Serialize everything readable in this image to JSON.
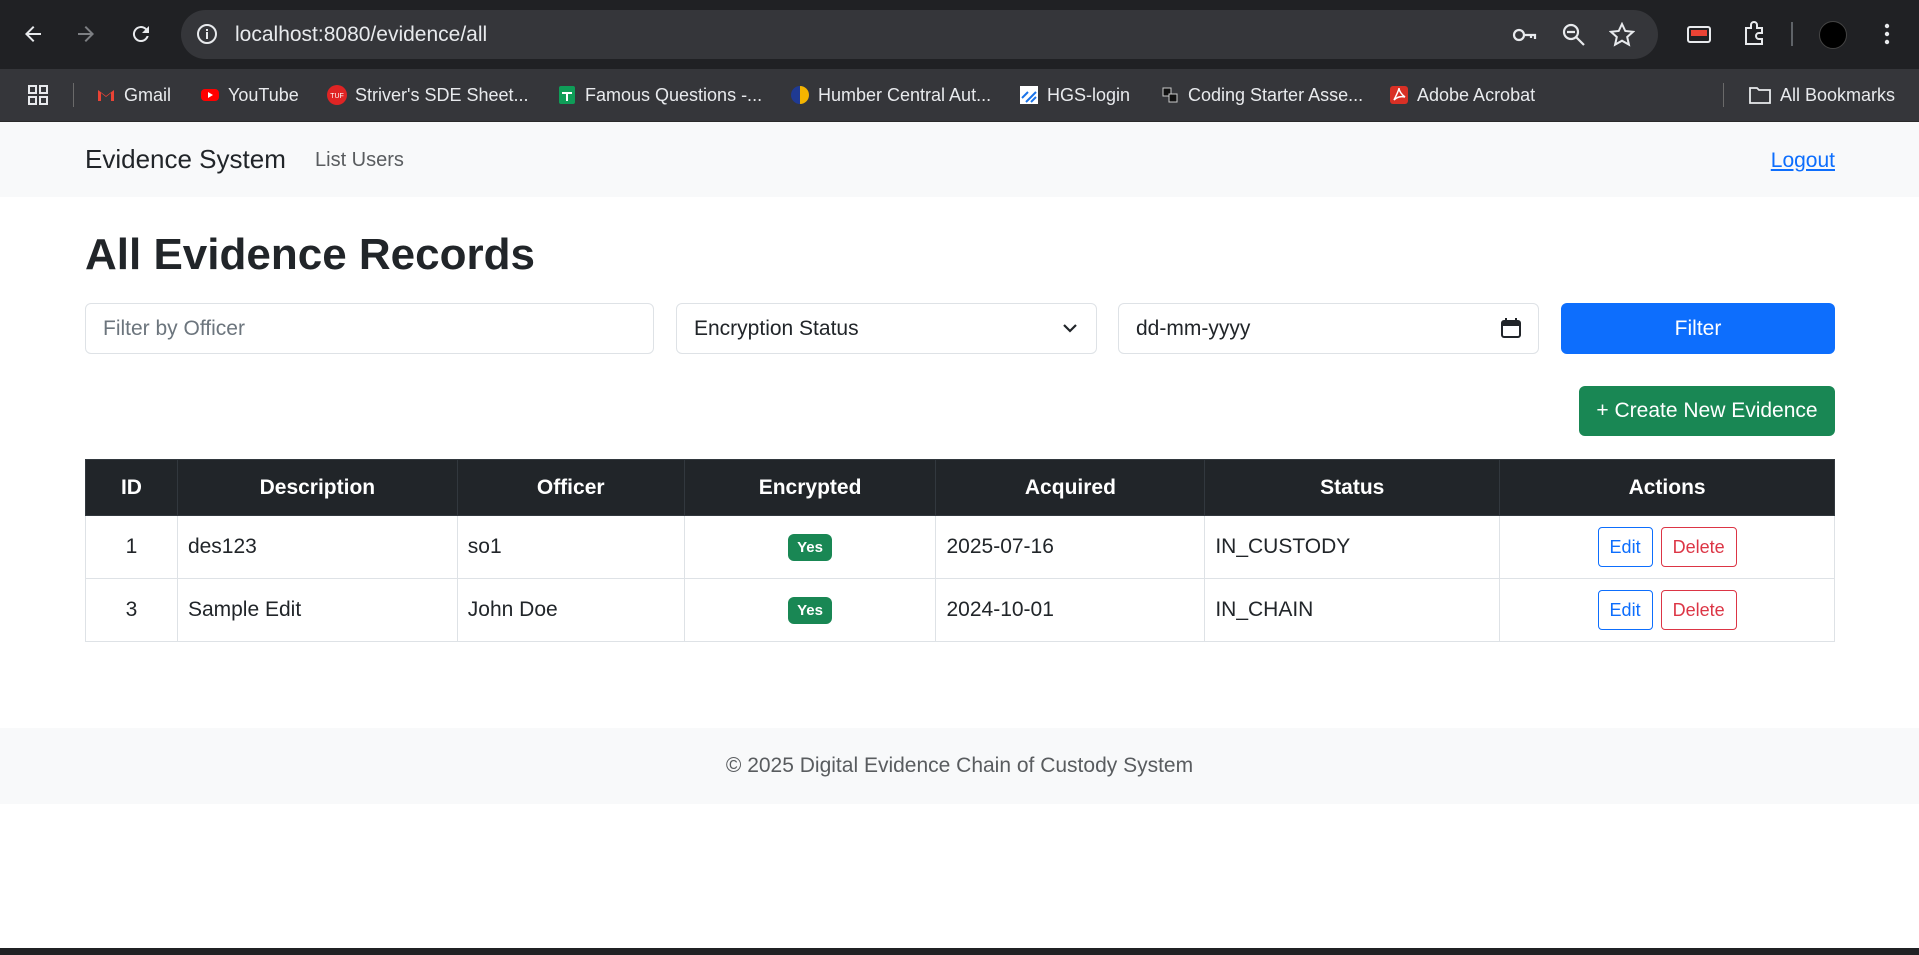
{
  "browser": {
    "url": "localhost:8080/evidence/all",
    "bookmarks": [
      {
        "label": "Gmail",
        "icon": "gmail-icon",
        "color": "#ea4335"
      },
      {
        "label": "YouTube",
        "icon": "youtube-icon",
        "color": "#ff0000"
      },
      {
        "label": "Striver's SDE Sheet...",
        "icon": "tuf-icon",
        "color": "#e02424"
      },
      {
        "label": "Famous Questions -...",
        "icon": "sheets-icon",
        "color": "#0f9d58"
      },
      {
        "label": "Humber Central Aut...",
        "icon": "humber-icon",
        "color": "#f4b400"
      },
      {
        "label": "HGS-login",
        "icon": "hgs-icon",
        "color": "#1a73e8"
      },
      {
        "label": "Coding Starter Asse...",
        "icon": "coding-icon",
        "color": "#ffffff"
      },
      {
        "label": "Adobe Acrobat",
        "icon": "acrobat-icon",
        "color": "#d93025"
      }
    ],
    "all_bookmarks": "All Bookmarks"
  },
  "nav": {
    "brand": "Evidence System",
    "list_users": "List Users",
    "logout": "Logout"
  },
  "page": {
    "title": "All Evidence Records"
  },
  "filters": {
    "officer_placeholder": "Filter by Officer",
    "encryption_label": "Encryption Status",
    "date_placeholder": "dd-mm-yyyy",
    "filter_button": "Filter",
    "create_button": "+ Create New Evidence"
  },
  "table": {
    "headers": [
      "ID",
      "Description",
      "Officer",
      "Encrypted",
      "Acquired",
      "Status",
      "Actions"
    ],
    "rows": [
      {
        "id": "1",
        "description": "des123",
        "officer": "so1",
        "encrypted": "Yes",
        "acquired": "2025-07-16",
        "status": "IN_CUSTODY",
        "edit": "Edit",
        "delete": "Delete"
      },
      {
        "id": "3",
        "description": "Sample Edit",
        "officer": "John Doe",
        "encrypted": "Yes",
        "acquired": "2024-10-01",
        "status": "IN_CHAIN",
        "edit": "Edit",
        "delete": "Delete"
      }
    ]
  },
  "footer": {
    "text": "© 2025 Digital Evidence Chain of Custody System"
  },
  "colors": {
    "primary": "#0d6efd",
    "success": "#198754",
    "danger": "#dc3545",
    "dark": "#212529"
  }
}
